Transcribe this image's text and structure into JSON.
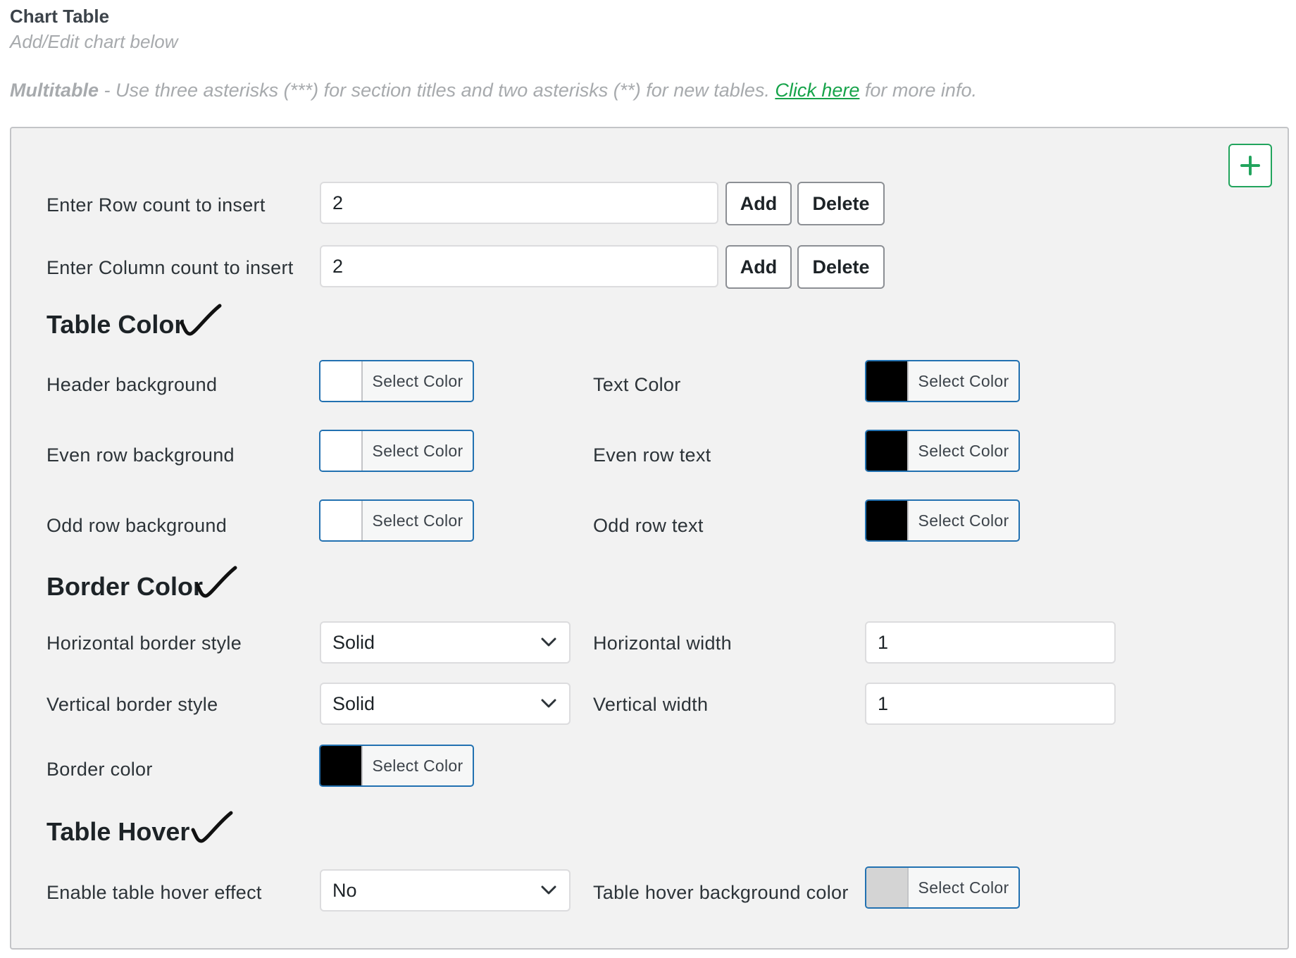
{
  "header": {
    "title": "Chart Table",
    "subtitle": "Add/Edit chart below",
    "notice_bold": "Multitable",
    "notice_text": " - Use three asterisks (***) for section titles and two asterisks (**) for new tables. ",
    "notice_link": "Click here",
    "notice_tail": " for more info."
  },
  "panel": {
    "add_icon": "plus-icon",
    "row_count": {
      "label": "Enter Row count to insert",
      "value": "2",
      "add": "Add",
      "delete": "Delete"
    },
    "col_count": {
      "label": "Enter Column count to insert",
      "value": "2",
      "add": "Add",
      "delete": "Delete"
    },
    "table_color": {
      "heading": "Table Color",
      "header_bg": {
        "label": "Header background",
        "button": "Select Color",
        "color": "#ffffff"
      },
      "text_color": {
        "label": "Text Color",
        "button": "Select Color",
        "color": "#000000"
      },
      "even_bg": {
        "label": "Even row background",
        "button": "Select Color",
        "color": "#ffffff"
      },
      "even_text": {
        "label": "Even row text",
        "button": "Select Color",
        "color": "#000000"
      },
      "odd_bg": {
        "label": "Odd row background",
        "button": "Select Color",
        "color": "#ffffff"
      },
      "odd_text": {
        "label": "Odd row text",
        "button": "Select Color",
        "color": "#000000"
      }
    },
    "border_color": {
      "heading": "Border Color",
      "h_style": {
        "label": "Horizontal border style",
        "value": "Solid"
      },
      "h_width": {
        "label": "Horizontal width",
        "value": "1"
      },
      "v_style": {
        "label": "Vertical border style",
        "value": "Solid"
      },
      "v_width": {
        "label": "Vertical width",
        "value": "1"
      },
      "border": {
        "label": "Border color",
        "button": "Select Color",
        "color": "#000000"
      }
    },
    "table_hover": {
      "heading": "Table Hover",
      "enable": {
        "label": "Enable table hover effect",
        "value": "No"
      },
      "hover_bg": {
        "label": "Table hover background color",
        "button": "Select Color",
        "color": "#d4d4d4"
      }
    }
  },
  "colors": {
    "accent": "#2271b1",
    "link": "#16a34a",
    "plus": "#22a45d"
  }
}
